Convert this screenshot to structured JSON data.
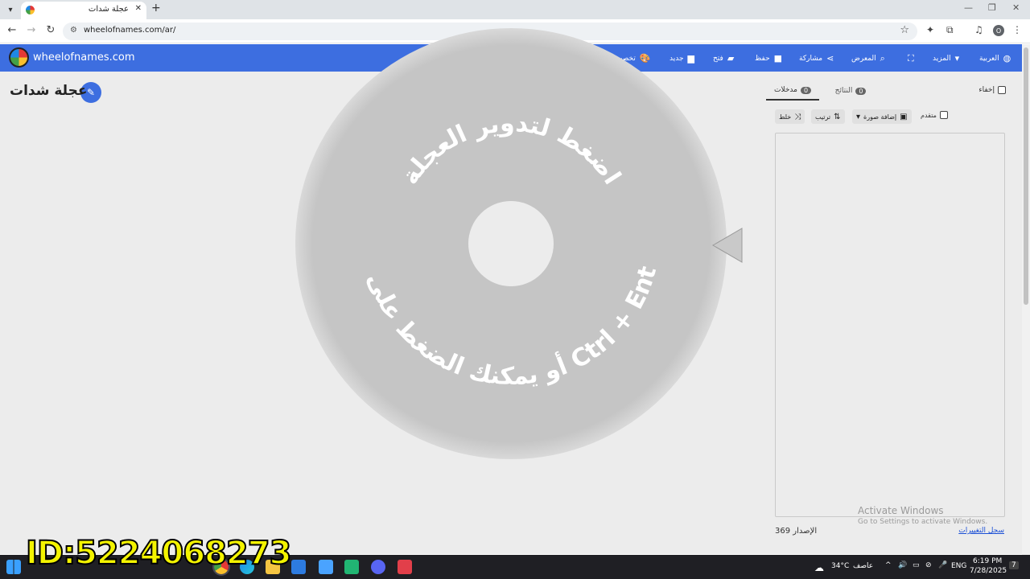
{
  "browser": {
    "tab_title": "عجلة شدات",
    "url": "wheelofnames.com/ar/",
    "profile_initial": "O"
  },
  "app": {
    "logo_text": "wheelofnames.com",
    "menu": {
      "customize": "تخصيص",
      "new": "جديد",
      "open": "فتح",
      "save": "حفظ",
      "share": "مشاركة",
      "gallery": "المعرض",
      "more": "المزيد",
      "language": "العربية"
    }
  },
  "wheel": {
    "title": "عجلة شدات",
    "text_top": "اضغط لتدوير العجلة",
    "text_bottom": "أو يمكنك الضغط على زر Ctrl + Enter",
    "color": "#c5c5c5"
  },
  "panel": {
    "tab_entries": "مدخلات",
    "entries_count": "0",
    "tab_results": "النتائج",
    "results_count": "0",
    "hide_label": "إخفاء",
    "shuffle_label": "خلط",
    "sort_label": "ترتيب",
    "add_image_label": "إضافة صورة",
    "advanced_label": "متقدم",
    "version": "الإصدار 369",
    "changelog": "سجل التغييرات"
  },
  "watermark": {
    "line1": "Activate Windows",
    "line2": "Go to Settings to activate Windows."
  },
  "taskbar": {
    "weather_temp": "34°C",
    "weather_desc": "عاصف",
    "lang": "ENG",
    "time": "6:19 PM",
    "date": "7/28/2025",
    "notif_count": "7"
  },
  "overlay_id": "ID:5224068273"
}
